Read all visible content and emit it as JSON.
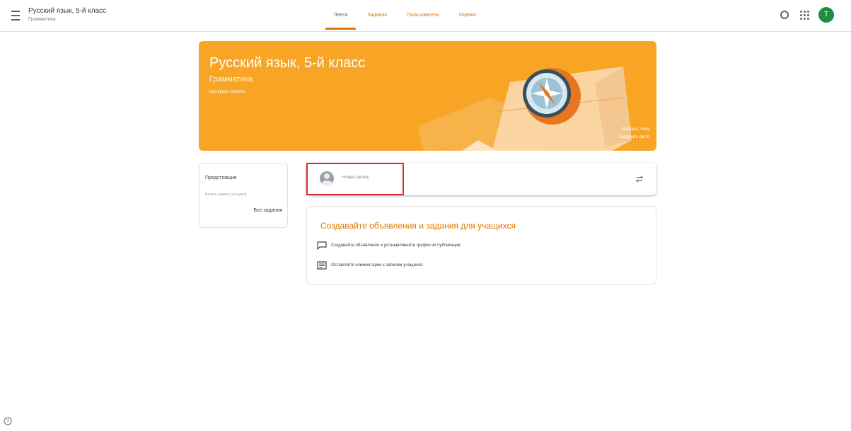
{
  "header": {
    "title": "Русский язык, 5-й класс",
    "subtitle": "Грамматика",
    "tabs": [
      {
        "label": "Лента"
      },
      {
        "label": "Задания"
      },
      {
        "label": "Пользователи"
      },
      {
        "label": "Оценки"
      }
    ],
    "avatar_letter": "Т"
  },
  "banner": {
    "title": "Русский язык, 5-й класс",
    "subtitle": "Грамматика",
    "course_code": "Код курса  ххххххх",
    "choose_theme": "Выбрать тему",
    "upload_photo": "Загрузить фото",
    "color": "#f8a526"
  },
  "upcoming": {
    "title": "Предстоящие",
    "empty_text": "Ничего сдавать не нужно",
    "all_tasks": "Все задания"
  },
  "new_post": {
    "placeholder": "Новая запись"
  },
  "info_card": {
    "title": "Создавайте объявления и задания для учащихся",
    "rows": [
      {
        "icon": "comment-icon",
        "text": "Создавайте объявления и устанавливайте график их публикации."
      },
      {
        "icon": "message-icon",
        "text": "Оставляйте комментарии к записям учащихся."
      }
    ]
  },
  "colors": {
    "accent": "#e37400",
    "highlight_border": "#d32f2f",
    "avatar_bg": "#1e8e3e"
  }
}
